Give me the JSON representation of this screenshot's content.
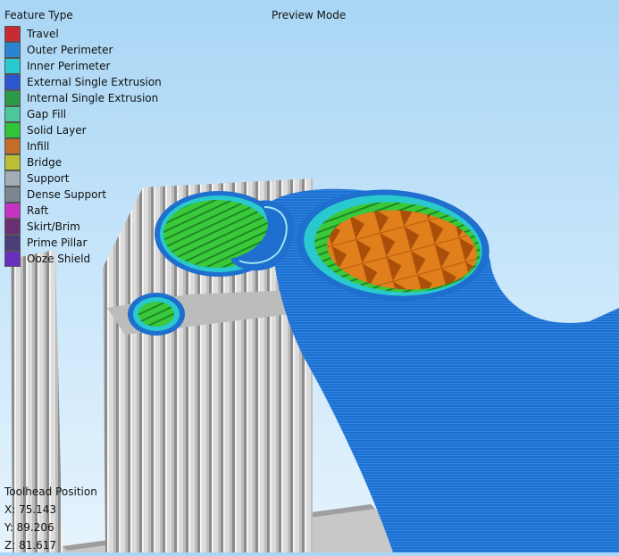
{
  "legend": {
    "title": "Feature Type",
    "items": [
      {
        "label": "Travel",
        "color": "#c62a34"
      },
      {
        "label": "Outer Perimeter",
        "color": "#2a84d2"
      },
      {
        "label": "Inner Perimeter",
        "color": "#2ac9cf"
      },
      {
        "label": "External Single Extrusion",
        "color": "#2a56cf"
      },
      {
        "label": "Internal Single Extrusion",
        "color": "#2a9a49"
      },
      {
        "label": "Gap Fill",
        "color": "#4cc79b"
      },
      {
        "label": "Solid Layer",
        "color": "#2fc43a"
      },
      {
        "label": "Infill",
        "color": "#c46c2a"
      },
      {
        "label": "Bridge",
        "color": "#bcbf35"
      },
      {
        "label": "Support",
        "color": "#a3adb5"
      },
      {
        "label": "Dense Support",
        "color": "#7b878f"
      },
      {
        "label": "Raft",
        "color": "#c433c4"
      },
      {
        "label": "Skirt/Brim",
        "color": "#6a2f73"
      },
      {
        "label": "Prime Pillar",
        "color": "#4a3d7a"
      },
      {
        "label": "Ooze Shield",
        "color": "#6a2fbf"
      }
    ]
  },
  "preview": {
    "mode_label": "Preview Mode"
  },
  "toolhead": {
    "title": "Toolhead Position",
    "x": "X: 75.143",
    "y": "Y: 89.206",
    "z": "Z: 81.617"
  }
}
